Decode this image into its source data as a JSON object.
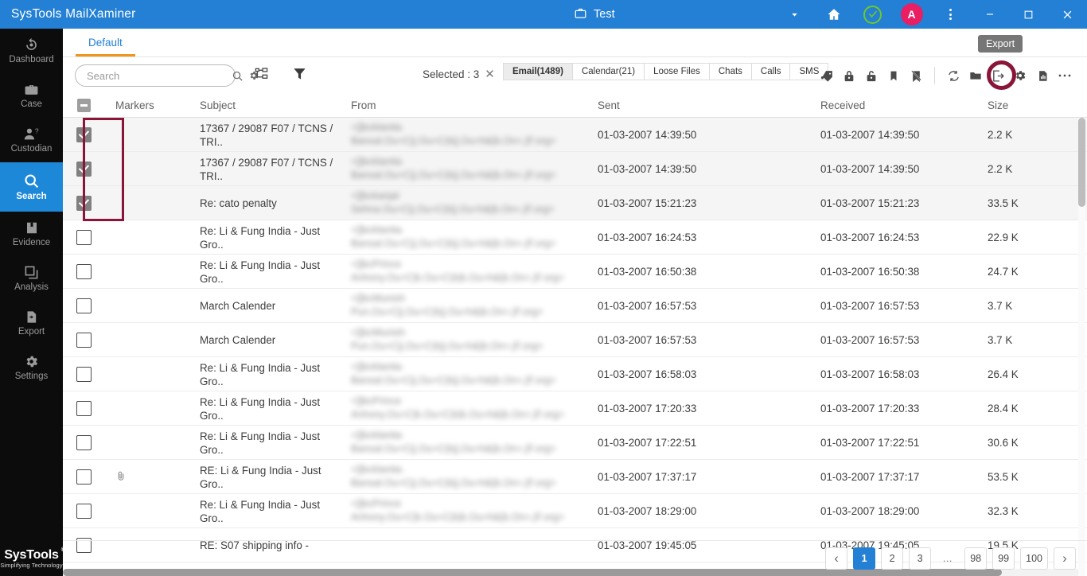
{
  "titlebar": {
    "app_title": "SysTools MailXaminer",
    "case_name": "Test",
    "case_icon": "briefcase-icon",
    "dropdown_icon": "chevron-down-icon",
    "home_icon": "home-icon",
    "status_icon": "check-circle-icon",
    "avatar_initial": "A",
    "more_icon": "kebab-menu-icon",
    "minimize_icon": "minimize-icon",
    "maximize_icon": "maximize-icon",
    "close_icon": "close-icon",
    "bg_color": "#2380d4",
    "avatar_color": "#e91e63",
    "status_color": "#6ec82a"
  },
  "sidebar": {
    "items": [
      {
        "label": "Dashboard",
        "icon": "dashboard-refresh-icon",
        "active": false
      },
      {
        "label": "Case",
        "icon": "briefcase-icon",
        "active": false
      },
      {
        "label": "Custodian",
        "icon": "person-question-icon",
        "active": false
      },
      {
        "label": "Search",
        "icon": "search-icon",
        "active": true
      },
      {
        "label": "Evidence",
        "icon": "book-icon",
        "active": false
      },
      {
        "label": "Analysis",
        "icon": "layers-icon",
        "active": false
      },
      {
        "label": "Export",
        "icon": "file-export-icon",
        "active": false
      },
      {
        "label": "Settings",
        "icon": "gear-icon",
        "active": false
      }
    ],
    "active_color": "#1e88d8",
    "brand_name": "SysTools",
    "brand_trademark": "®",
    "brand_tagline": "Simplifying Technology"
  },
  "tabs": {
    "default_tab": "Default",
    "underline_color": "#f0961e"
  },
  "toolbar": {
    "search_placeholder": "Search",
    "search_value": "",
    "search_icon": "search-icon",
    "search_settings_icon": "gear-icon",
    "tree_icon": "tree-view-icon",
    "filter_icon": "funnel-filter-icon",
    "selected_label": "Selected : 3",
    "selected_clear_icon": "close-icon",
    "segments": [
      {
        "label": "Email(1489)",
        "active": true
      },
      {
        "label": "Calendar(21)",
        "active": false
      },
      {
        "label": "Loose Files",
        "active": false
      },
      {
        "label": "Chats",
        "active": false
      },
      {
        "label": "Calls",
        "active": false
      },
      {
        "label": "SMS",
        "active": false
      }
    ],
    "right_icons": [
      "tag-add-icon",
      "lock-closed-icon",
      "lock-open-icon",
      "bookmark-icon",
      "bookmark-off-icon",
      "refresh-icon",
      "folder-icon",
      "export-icon",
      "gear-icon",
      "report-chart-icon",
      "more-horizontal-icon"
    ],
    "tooltip": "Export",
    "highlight_color": "#8a1538"
  },
  "table": {
    "columns": [
      "Markers",
      "Subject",
      "From",
      "Sent",
      "Received",
      "Size"
    ],
    "header_select_icon": "indeterminate-checkbox-icon",
    "rows": [
      {
        "checked": true,
        "marker": "",
        "subject": "17367 / 29087 F07 / TCNS / TRI..",
        "from": "<|]bcklanita Bansal.Ou=C|j.Ou=C(k|j.Ou=h&|b.On=,|F.org>",
        "sent": "01-03-2007 14:39:50",
        "received": "01-03-2007 14:39:50",
        "size": "2.2 K"
      },
      {
        "checked": true,
        "marker": "",
        "subject": "17367 / 29087 F07 / TCNS / TRI..",
        "from": "<|]bcklanita Bansal.Ou=C|j.Ou=C(k|j.Ou=h&|b.On=,|F.org>",
        "sent": "01-03-2007 14:39:50",
        "received": "01-03-2007 14:39:50",
        "size": "2.2 K"
      },
      {
        "checked": true,
        "marker": "",
        "subject": "Re: cato penalty",
        "from": "<|]bckanjal Sehna.Ou=C|j.Ou=C(k|j.Ou=h&|b.On=,|F.org>",
        "sent": "01-03-2007 15:21:23",
        "received": "01-03-2007 15:21:23",
        "size": "33.5 K"
      },
      {
        "checked": false,
        "marker": "",
        "subject": "Re: Li & Fung India - Just Gro..",
        "from": "<|]bcklanita Bansal.Ou=C|j.Ou=C(k|j.Ou=h&|b.On=,|F.org>",
        "sent": "01-03-2007 16:24:53",
        "received": "01-03-2007 16:24:53",
        "size": "22.9 K"
      },
      {
        "checked": false,
        "marker": "",
        "subject": "Re: Li & Fung India - Just Gro..",
        "from": "<|]bcPrince Anhony.Ou=C|k.Ou=C(k|k.Ou=h&|b.On=,|F.org>",
        "sent": "01-03-2007 16:50:38",
        "received": "01-03-2007 16:50:38",
        "size": "24.7 K"
      },
      {
        "checked": false,
        "marker": "",
        "subject": "March Calender",
        "from": "<|]bcMunish Pun.Ou=C|j.Ou=C(k|j.Ou=h&|b.On=,|F.org>",
        "sent": "01-03-2007 16:57:53",
        "received": "01-03-2007 16:57:53",
        "size": "3.7 K"
      },
      {
        "checked": false,
        "marker": "",
        "subject": "March Calender",
        "from": "<|]bcMunish Pun.Ou=C|j.Ou=C(k|j.Ou=h&|b.On=,|F.org>",
        "sent": "01-03-2007 16:57:53",
        "received": "01-03-2007 16:57:53",
        "size": "3.7 K"
      },
      {
        "checked": false,
        "marker": "",
        "subject": "Re: Li & Fung India - Just Gro..",
        "from": "<|]bcklanita Bansal.Ou=C|j.Ou=C(k|j.Ou=h&|b.On=,|F.org>",
        "sent": "01-03-2007 16:58:03",
        "received": "01-03-2007 16:58:03",
        "size": "26.4 K"
      },
      {
        "checked": false,
        "marker": "",
        "subject": "Re: Li & Fung India - Just Gro..",
        "from": "<|]bcPrince Anhony.Ou=C|k.Ou=C(k|k.Ou=h&|b.On=,|F.org>",
        "sent": "01-03-2007 17:20:33",
        "received": "01-03-2007 17:20:33",
        "size": "28.4 K"
      },
      {
        "checked": false,
        "marker": "",
        "subject": "Re: Li & Fung India - Just Gro..",
        "from": "<|]bcklanita Bansal.Ou=C|j.Ou=C(k|j.Ou=h&|b.On=,|F.org>",
        "sent": "01-03-2007 17:22:51",
        "received": "01-03-2007 17:22:51",
        "size": "30.6 K"
      },
      {
        "checked": false,
        "marker": "attachment-icon",
        "subject": "RE: Li & Fung India - Just Gro..",
        "from": "<|]bcklanita Bansal.Ou=C|j.Ou=C(k|j.Ou=h&|b.On=,|F.org>",
        "sent": "01-03-2007 17:37:17",
        "received": "01-03-2007 17:37:17",
        "size": "53.5 K"
      },
      {
        "checked": false,
        "marker": "",
        "subject": "Re: Li & Fung India - Just Gro..",
        "from": "<|]bcPrince Anhony.Ou=C|k.Ou=C(k|k.Ou=h&|b.On=,|F.org>",
        "sent": "01-03-2007 18:29:00",
        "received": "01-03-2007 18:29:00",
        "size": "32.3 K"
      },
      {
        "checked": false,
        "marker": "",
        "subject": "RE: S07 shipping info -",
        "from": "",
        "sent": "01-03-2007 19:45:05",
        "received": "01-03-2007 19:45:05",
        "size": "19.5 K"
      }
    ]
  },
  "pagination": {
    "prev_icon": "chevron-left-icon",
    "next_icon": "chevron-right-icon",
    "pages": [
      "1",
      "2",
      "3",
      "…",
      "98",
      "99",
      "100"
    ],
    "current": "1",
    "active_color": "#2380d4"
  }
}
